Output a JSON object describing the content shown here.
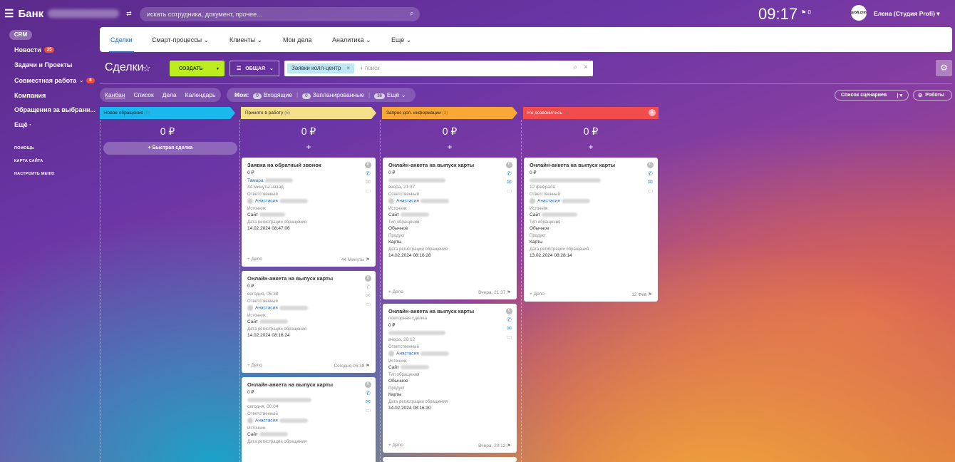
{
  "top": {
    "app": "Банк",
    "search_placeholder": "искать сотрудника, документ, прочее...",
    "time": "09:17",
    "flag_count": "0",
    "avatar_text": "profi.crm",
    "user": "Елена (Студия Profi)"
  },
  "sidebar": {
    "crm": "CRM",
    "items": [
      {
        "label": "Новости",
        "badge": "35"
      },
      {
        "label": "Задачи и Проекты"
      },
      {
        "label": "Совместная работа",
        "badge": "8"
      },
      {
        "label": "Компания"
      },
      {
        "label": "Обращения за выбранн..."
      },
      {
        "label": "Ещё ·"
      }
    ],
    "small": [
      "ПОМОЩЬ",
      "КАРТА САЙТА",
      "НАСТРОИТЬ МЕНЮ"
    ]
  },
  "nav": {
    "tabs": [
      "Сделки",
      "Смарт-процессы",
      "Клиенты",
      "Мои дела",
      "Аналитика",
      "Еще"
    ]
  },
  "toolbar": {
    "title": "Сделки",
    "create": "СОЗДАТЬ",
    "general": "ОБЩАЯ",
    "chip": "Заявки колл-центр",
    "filter_placeholder": "+ поиск"
  },
  "views": {
    "items": [
      "Канбан",
      "Список",
      "Дела",
      "Календарь"
    ],
    "mine": "Мои:",
    "incoming": "Входящие",
    "incoming_n": "0",
    "planned": "Запланированные",
    "planned_n": "0",
    "more": "Ещё",
    "more_n": "36",
    "scenarios": "Список сценариев",
    "robots": "Роботы"
  },
  "columns": [
    {
      "name": "Новое обращение",
      "count": "(0)",
      "sum": "0 ₽",
      "color": "#1ab8ec"
    },
    {
      "name": "Принято в работу",
      "count": "(6)",
      "sum": "0 ₽",
      "color": "#f5e08a"
    },
    {
      "name": "Запрос доп. информации",
      "count": "(3)",
      "sum": "0 ₽",
      "color": "#f9a837"
    },
    {
      "name": "Не дозвонились",
      "count": "(1)",
      "sum": "0 ₽",
      "color": "#f24c4c"
    }
  ],
  "quick_deal": "+ Быстрая сделка",
  "labels": {
    "resp": "Ответственный",
    "source": "Источник",
    "regdate": "Дата регистрации обращения",
    "type": "Тип обращения",
    "product": "Продукт",
    "add": "+ Дело"
  },
  "cards": {
    "c1": {
      "title": "Заявка на обратный звонок",
      "sum": "0 ₽",
      "client": "Тамара",
      "ago": "44 минуты назад",
      "person": "Анастасия",
      "source": "Сайт",
      "date": "14.02.2024 08:47:06",
      "foot": "44 Минуты",
      "n": "0"
    },
    "c2": {
      "title": "Онлайн-анкета на выпуск карты",
      "sum": "0 ₽",
      "ago": "сегодня, 05:38",
      "person": "Анастасия",
      "source": "Сайт",
      "date": "14.02.2024 08:16:24",
      "foot": "Сегодня 05:38",
      "n": "0"
    },
    "c3": {
      "title": "Онлайн-анкета на выпуск карты",
      "sum": "0 ₽",
      "ago": "сегодня, 00:04",
      "person": "Анастасия",
      "source": "Сайт",
      "n": "0"
    },
    "c4": {
      "title": "Онлайн-анкета на выпуск карты",
      "sum": "0 ₽",
      "ago": "вчера, 21:37",
      "person": "Анастасия",
      "source": "Сайт",
      "type": "Обычное",
      "product": "Карты",
      "date": "14.02.2024 08:16:28",
      "foot": "Вчера, 21:37",
      "n": "0"
    },
    "c5": {
      "title": "Онлайн-анкета на выпуск карты",
      "sub": "повторная сделка",
      "sum": "0 ₽",
      "ago": "вчера, 20:12",
      "person": "Анастасия",
      "source": "Сайт",
      "type": "Обычное",
      "product": "Карты",
      "date": "14.02.2024 08:16:30",
      "foot": "Вчера, 20:12",
      "n": "0"
    },
    "c6": {
      "title": "Онлайн-анкета на выпуск карты",
      "sum": "0 ₽",
      "ago": "12 февраля",
      "person": "Анастасия",
      "source": "Сайт",
      "type": "Обычное",
      "product": "Карты",
      "date": "13.02.2024 08:28:14",
      "foot": "12 Фев",
      "n": "0"
    }
  }
}
